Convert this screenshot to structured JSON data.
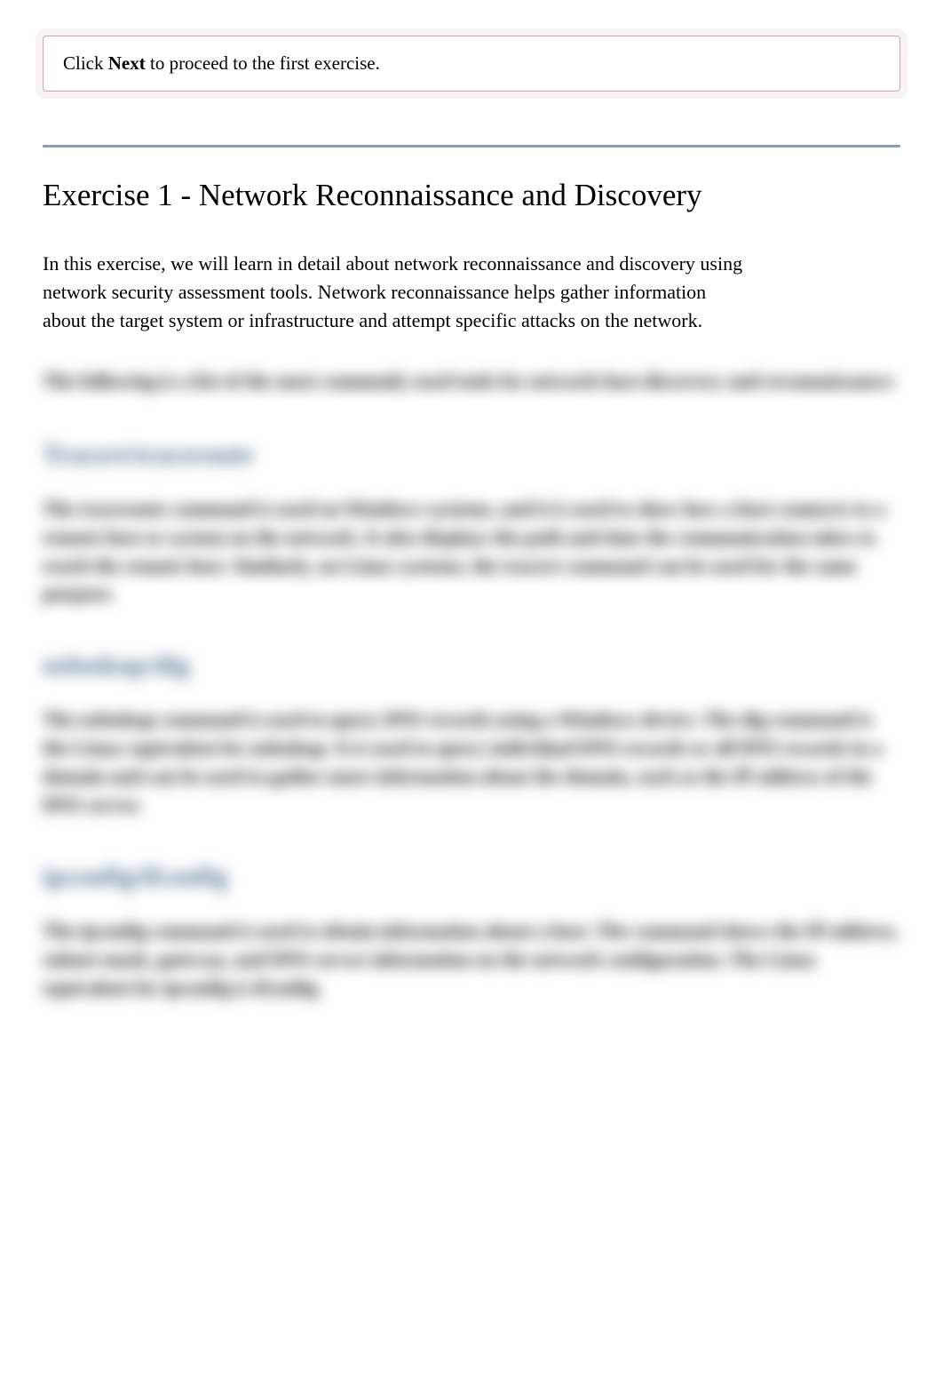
{
  "callout": {
    "text_prefix": "Click ",
    "text_bold": "Next",
    "text_suffix": " to proceed to the first exercise."
  },
  "exercise": {
    "title": "Exercise 1 - Network Reconnaissance and Discovery",
    "intro": "In this exercise, we will learn in detail about network reconnaissance and discovery using network security assessment tools. Network reconnaissance helps gather information about the target system or infrastructure and attempt specific attacks on the network."
  },
  "blurred": {
    "lead": "The following is a list of the most commonly used tools for network host discovery and reconnaissance:",
    "section1": {
      "heading": "Tracert/traceroute",
      "body": "The traceroute command is used on Windows systems, and it is used to show how a host connects to a remote host or system on the network. It also displays the path and time the communication takes to reach the remote host. Similarly, on Linux systems, the tracert command can be used for the same purpose."
    },
    "section2": {
      "heading": "nslookup/dig",
      "body": "The nslookup command is used to query DNS records using a Windows device. The dig command is the Linux equivalent for nslookup. It is used to query individual DNS records or all DNS records in a domain and can be used to gather more information about the domain, such as the IP address of the DNS server."
    },
    "section3": {
      "heading": "ipconfig/ifconfig",
      "body": "The ipconfig command is used to obtain information about a host. The command shows the IP address, subnet mask, gateway, and DNS server information on the network configuration. The Linux equivalent for ipconfig is ifconfig."
    }
  }
}
